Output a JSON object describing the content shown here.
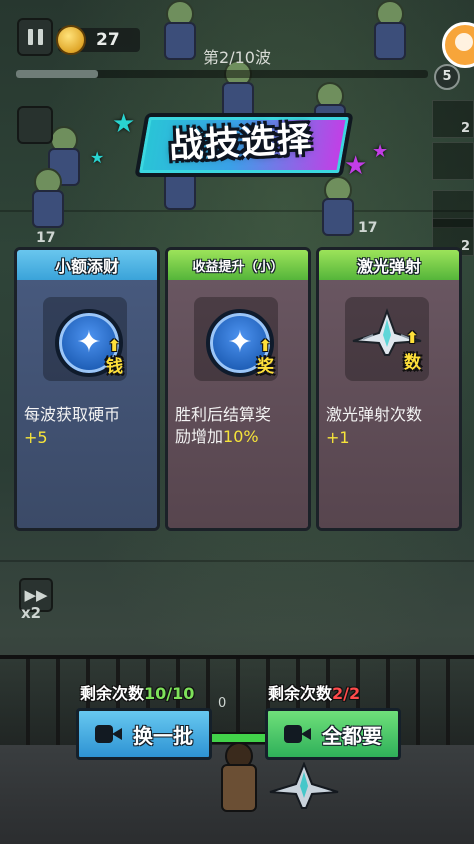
{
  "hud": {
    "coins": "27",
    "wave_label": "第2/10波",
    "wave_progress": 0.2,
    "wave_badge": "5"
  },
  "title": "战技选择",
  "cards": [
    {
      "header": "小额添财",
      "icon": "coin-badge-icon",
      "icon_tag": "钱",
      "desc": "每波获取硬币",
      "value": "+5"
    },
    {
      "header": "收益提升（小）",
      "icon": "reward-badge-icon",
      "icon_tag": "奖",
      "desc_1": "胜利后结算奖",
      "desc_2_prefix": "励增加",
      "desc_2_value": "10%"
    },
    {
      "header": "激光弹射",
      "icon": "laser-jet-icon",
      "icon_tag": "数",
      "desc": "激光弹射次数",
      "value": "+1"
    }
  ],
  "side": {
    "speed_label": "x2",
    "right_counts": [
      "2",
      "2"
    ],
    "floor_left": "17",
    "floor_right": "17"
  },
  "bottom": {
    "refresh": {
      "label": "剩余次数",
      "count": "10/10",
      "button": "换一批"
    },
    "take_all": {
      "label": "剩余次数",
      "count": "2/2",
      "button": "全都要"
    },
    "small_counter": "0"
  },
  "colors": {
    "refresh_button": "#2e93d3",
    "take_all_button": "#2fb05a",
    "highlight": "#f6e43a",
    "count_green": "#7ee25a",
    "count_red": "#ff4b4b"
  }
}
